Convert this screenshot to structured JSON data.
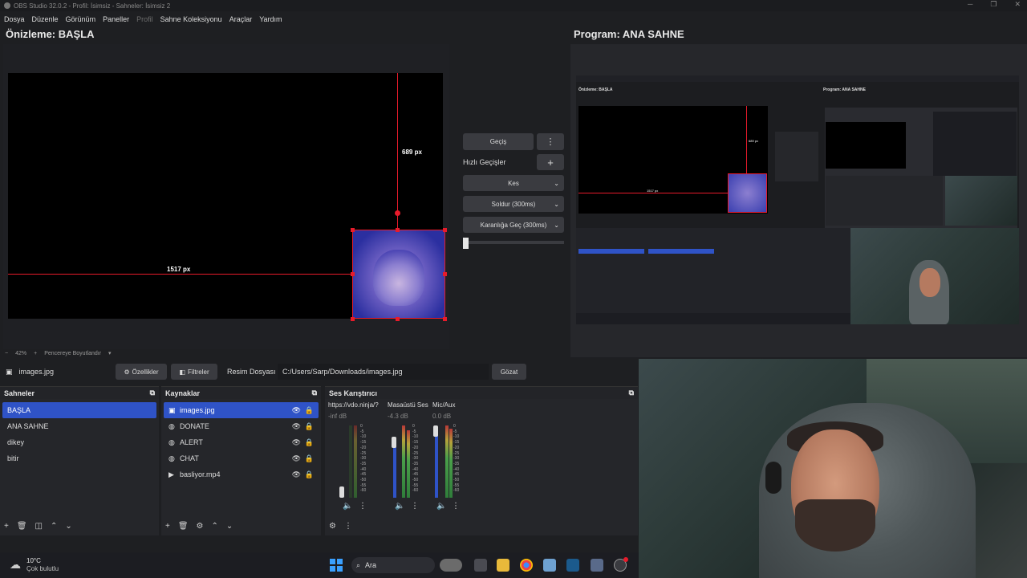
{
  "window": {
    "title": "OBS Studio 32.0.2 - Profil: İsimsiz - Sahneler: İsimsiz 2"
  },
  "menu": {
    "items": [
      "Dosya",
      "Düzenle",
      "Görünüm",
      "Paneller",
      "Profil",
      "Sahne Koleksiyonu",
      "Araçlar",
      "Yardım"
    ]
  },
  "preview": {
    "title": "Önizleme: BAŞLA",
    "guide_h_label": "1517 px",
    "guide_v_label": "689 px",
    "zoom_minus": "−",
    "zoom_value": "42%",
    "zoom_plus": "+",
    "fit_label": "Pencereye Boyutlandır"
  },
  "program": {
    "title": "Program: ANA SAHNE"
  },
  "transitions": {
    "transition_button": "Geçiş",
    "quick_label": "Hızlı Geçişler",
    "items": [
      "Kes",
      "Soldur (300ms)",
      "Karanlığa Geç (300ms)"
    ]
  },
  "source_bar": {
    "name": "images.jpg",
    "properties": "Özellikler",
    "filters": "Filtreler",
    "file_label": "Resim Dosyası",
    "file_path": "C:/Users/Sarp/Downloads/images.jpg",
    "browse": "Gözat"
  },
  "scenes": {
    "title": "Sahneler",
    "items": [
      "BAŞLA",
      "ANA SAHNE",
      "dikey",
      "bitir"
    ]
  },
  "sources": {
    "title": "Kaynaklar",
    "items": [
      "images.jpg",
      "DONATE",
      "ALERT",
      "CHAT",
      "basliyor.mp4"
    ]
  },
  "mixer": {
    "title": "Ses Karıştırıcı",
    "channels": [
      {
        "name": "https://vdo.ninja/?",
        "db": "-inf dB",
        "level": 0.0
      },
      {
        "name": "Masaüstü Ses",
        "db": "-4.3 dB",
        "level": 0.85
      },
      {
        "name": "Mic/Aux",
        "db": "0.0 dB",
        "level": 1.0
      }
    ],
    "scale": [
      "0",
      "-5",
      "-10",
      "-15",
      "-20",
      "-25",
      "-30",
      "-35",
      "-40",
      "-45",
      "-50",
      "-55",
      "-60"
    ]
  },
  "taskbar": {
    "weather_temp": "10°C",
    "weather_desc": "Çok bulutlu",
    "search": "Ara"
  },
  "program_preview_text": {
    "preview_title": "Önizleme: BAŞLA",
    "program_title": "Program: ANA SAHNE",
    "guide_h_label": "1517 px",
    "guide_v_label": "689 px"
  }
}
